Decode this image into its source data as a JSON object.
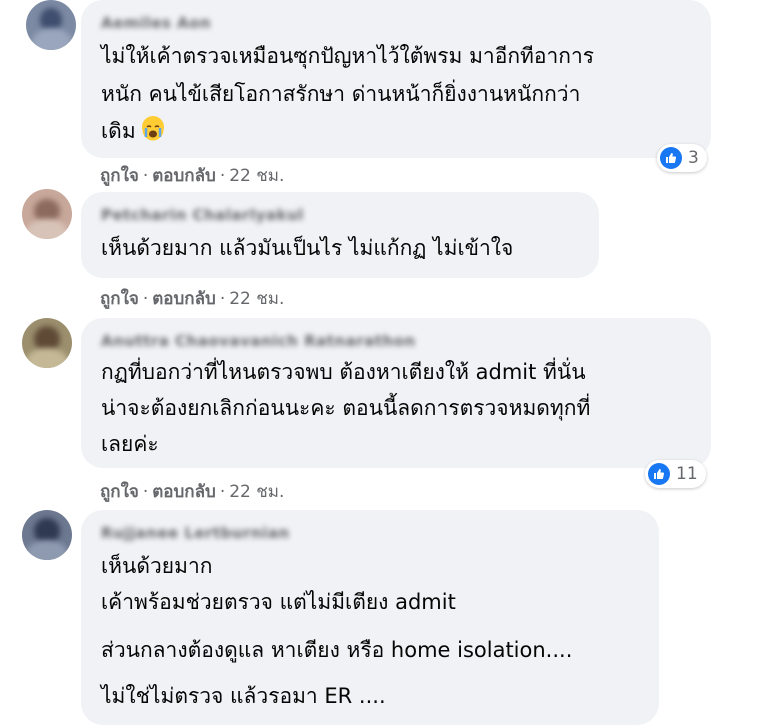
{
  "comments": [
    {
      "author": "Aemiles Aon",
      "lines": [
        "ไม่ให้เค้าตรวจเหมือนซุกปัญหาไว้ใต้พรม มาอีกทีอาการ",
        "หนัก คนไข้เสียโอกาสรักษา ด่านหน้าก็ยิ่งงานหนักกว่า",
        "เดิม"
      ],
      "emoji_icon": "crying-face-emoji",
      "like_label": "ถูกใจ",
      "reply_label": "ตอบกลับ",
      "time": "22 ชม.",
      "reaction_count": "3"
    },
    {
      "author": "Petcharin Chalarlyakul",
      "lines": [
        "เห็นด้วยมาก แล้วมันเป็นไร ไม่แก้กฏ ไม่เข้าใจ"
      ],
      "like_label": "ถูกใจ",
      "reply_label": "ตอบกลับ",
      "time": "22 ชม."
    },
    {
      "author": "Anuttra Chaovavanich Ratnarathon",
      "lines": [
        "กฏที่บอกว่าที่ไหนตรวจพบ ต้องหาเตียงให้ admit ที่นั่น",
        "น่าจะต้องยกเลิกก่อนนะคะ ตอนนี้ลดการตรวจหมดทุกที่",
        "เลยค่ะ"
      ],
      "like_label": "ถูกใจ",
      "reply_label": "ตอบกลับ",
      "time": "22 ชม.",
      "reaction_count": "11"
    },
    {
      "author": "Rujjanee Lertburnian",
      "lines": [
        "เห็นด้วยมาก",
        "เค้าพร้อมช่วยตรวจ แต่ไม่มีเตียง admit",
        "ส่วนกลางต้องดูแล หาเตียง หรือ home isolation....",
        "ไม่ใช่ไม่ตรวจ แล้วรอมา ER ...."
      ]
    }
  ],
  "colors": {
    "bubble": "#f0f2f5",
    "meta_text": "#65676b",
    "like_blue": "#1877f2"
  },
  "icons": [
    "like-icon",
    "crying-face-emoji"
  ]
}
